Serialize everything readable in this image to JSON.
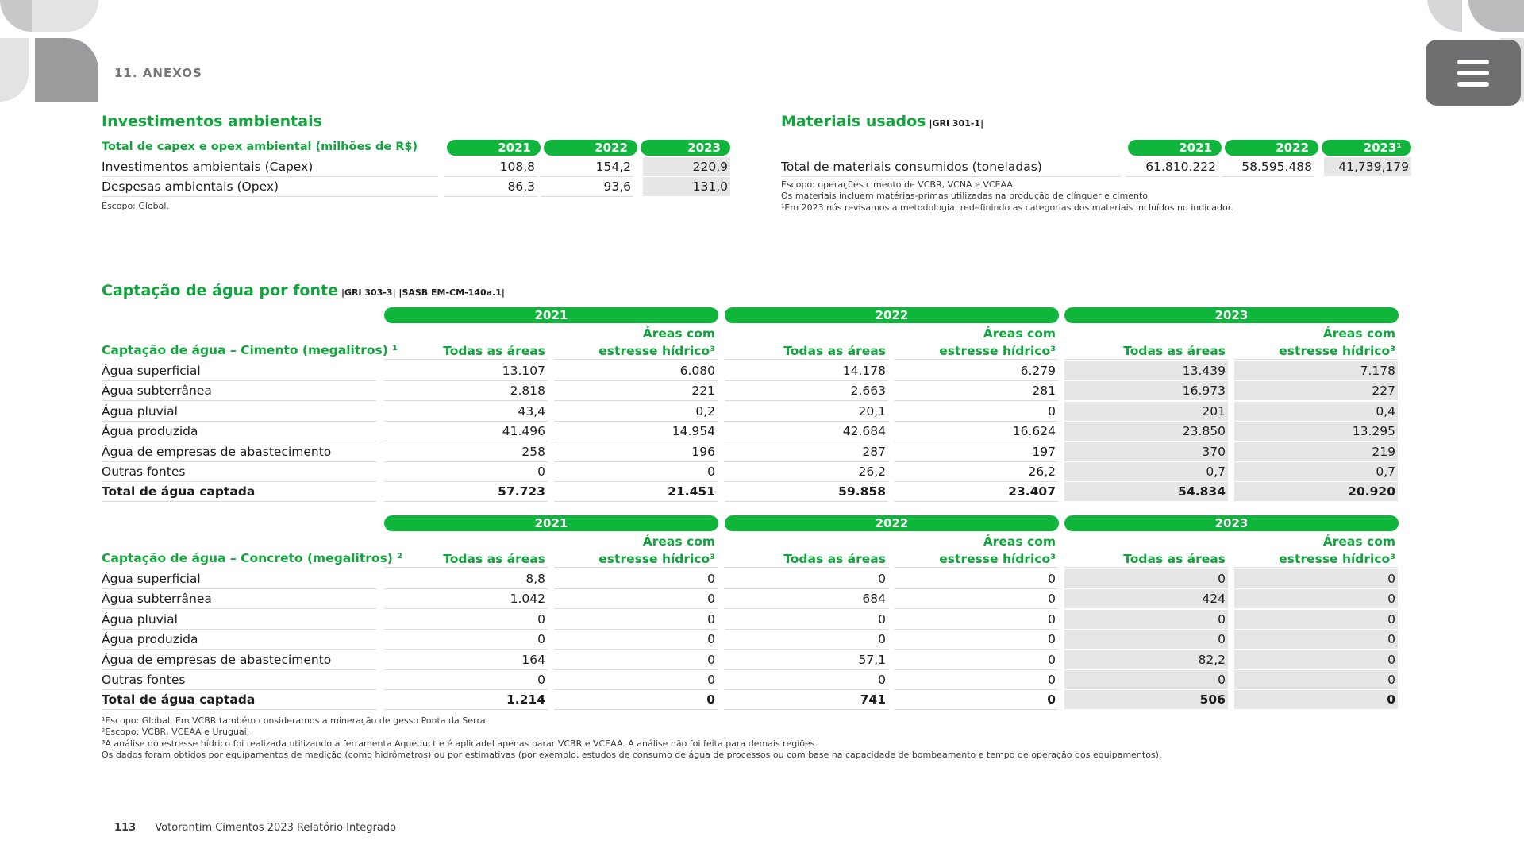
{
  "header": {
    "section": "11. ANEXOS"
  },
  "invest": {
    "title": "Investimentos ambientais",
    "row_head": "Total de capex e opex ambiental (milhões de R$)",
    "years": [
      "2021",
      "2022",
      "2023"
    ],
    "rows": [
      {
        "label": "Investimentos ambientais (Capex)",
        "values": [
          "108,8",
          "154,2",
          "220,9"
        ]
      },
      {
        "label": "Despesas ambientais (Opex)",
        "values": [
          "86,3",
          "93,6",
          "131,0"
        ]
      }
    ],
    "note": "Escopo: Global."
  },
  "materiais": {
    "title": "Materiais usados",
    "ref": "|GRI 301-1|",
    "years": [
      "2021",
      "2022",
      "2023¹"
    ],
    "row": {
      "label": "Total de materiais consumidos (toneladas)",
      "values": [
        "61.810.222",
        "58.595.488",
        "41,739,179"
      ]
    },
    "notes": [
      "Escopo: operações cimento de VCBR, VCNA e VCEAA.",
      "Os materiais incluem matérias-primas utilizadas na produção de clínquer e cimento.",
      "¹Em 2023 nós revisamos a metodologia, redefinindo as categorias dos materiais incluídos no indicador."
    ]
  },
  "agua": {
    "title": "Captação de água por fonte",
    "ref": "|GRI 303-3| |SASB EM-CM-140a.1|",
    "years": [
      "2021",
      "2022",
      "2023"
    ],
    "col_all": "Todas as áreas",
    "col_stress_1": "Áreas com",
    "col_stress_2": "estresse hídrico³",
    "cimento": {
      "head": "Captação de água – Cimento (megalitros) ¹",
      "rows": [
        {
          "label": "Água superficial",
          "values": [
            "13.107",
            "6.080",
            "14.178",
            "6.279",
            "13.439",
            "7.178"
          ]
        },
        {
          "label": "Água subterrânea",
          "values": [
            "2.818",
            "221",
            "2.663",
            "281",
            "16.973",
            "227"
          ]
        },
        {
          "label": "Água pluvial",
          "values": [
            "43,4",
            "0,2",
            "20,1",
            "0",
            "201",
            "0,4"
          ]
        },
        {
          "label": "Água produzida",
          "values": [
            "41.496",
            "14.954",
            "42.684",
            "16.624",
            "23.850",
            "13.295"
          ]
        },
        {
          "label": "Água de empresas de abastecimento",
          "values": [
            "258",
            "196",
            "287",
            "197",
            "370",
            "219"
          ]
        },
        {
          "label": "Outras fontes",
          "values": [
            "0",
            "0",
            "26,2",
            "26,2",
            "0,7",
            "0,7"
          ]
        },
        {
          "label": "Total de água captada",
          "values": [
            "57.723",
            "21.451",
            "59.858",
            "23.407",
            "54.834",
            "20.920"
          ]
        }
      ]
    },
    "concreto": {
      "head": "Captação de água – Concreto (megalitros) ²",
      "rows": [
        {
          "label": "Água superficial",
          "values": [
            "8,8",
            "0",
            "0",
            "0",
            "0",
            "0"
          ]
        },
        {
          "label": "Água subterrânea",
          "values": [
            "1.042",
            "0",
            "684",
            "0",
            "424",
            "0"
          ]
        },
        {
          "label": "Água pluvial",
          "values": [
            "0",
            "0",
            "0",
            "0",
            "0",
            "0"
          ]
        },
        {
          "label": "Água produzida",
          "values": [
            "0",
            "0",
            "0",
            "0",
            "0",
            "0"
          ]
        },
        {
          "label": "Água de empresas de abastecimento",
          "values": [
            "164",
            "0",
            "57,1",
            "0",
            "82,2",
            "0"
          ]
        },
        {
          "label": "Outras fontes",
          "values": [
            "0",
            "0",
            "0",
            "0",
            "0",
            "0"
          ]
        },
        {
          "label": "Total de água captada",
          "values": [
            "1.214",
            "0",
            "741",
            "0",
            "506",
            "0"
          ]
        }
      ]
    },
    "notes": [
      "¹Escopo: Global. Em VCBR também consideramos a mineração de gesso Ponta da Serra.",
      "²Escopo: VCBR, VCEAA e Uruguai.",
      "³A análise do estresse hídrico foi realizada utilizando a ferramenta Aqueduct e é aplicadel apenas parar VCBR e VCEAA. A análise não foi feita para demais regiões.",
      "Os dados foram obtidos por equipamentos de medição (como hidrômetros) ou por estimativas (por exemplo, estudos de consumo de água de processos ou com base na capacidade de bombeamento e tempo de operação dos equipamentos)."
    ]
  },
  "footer": {
    "page": "113",
    "doc": "Votorantim Cimentos 2023 Relatório Integrado"
  }
}
